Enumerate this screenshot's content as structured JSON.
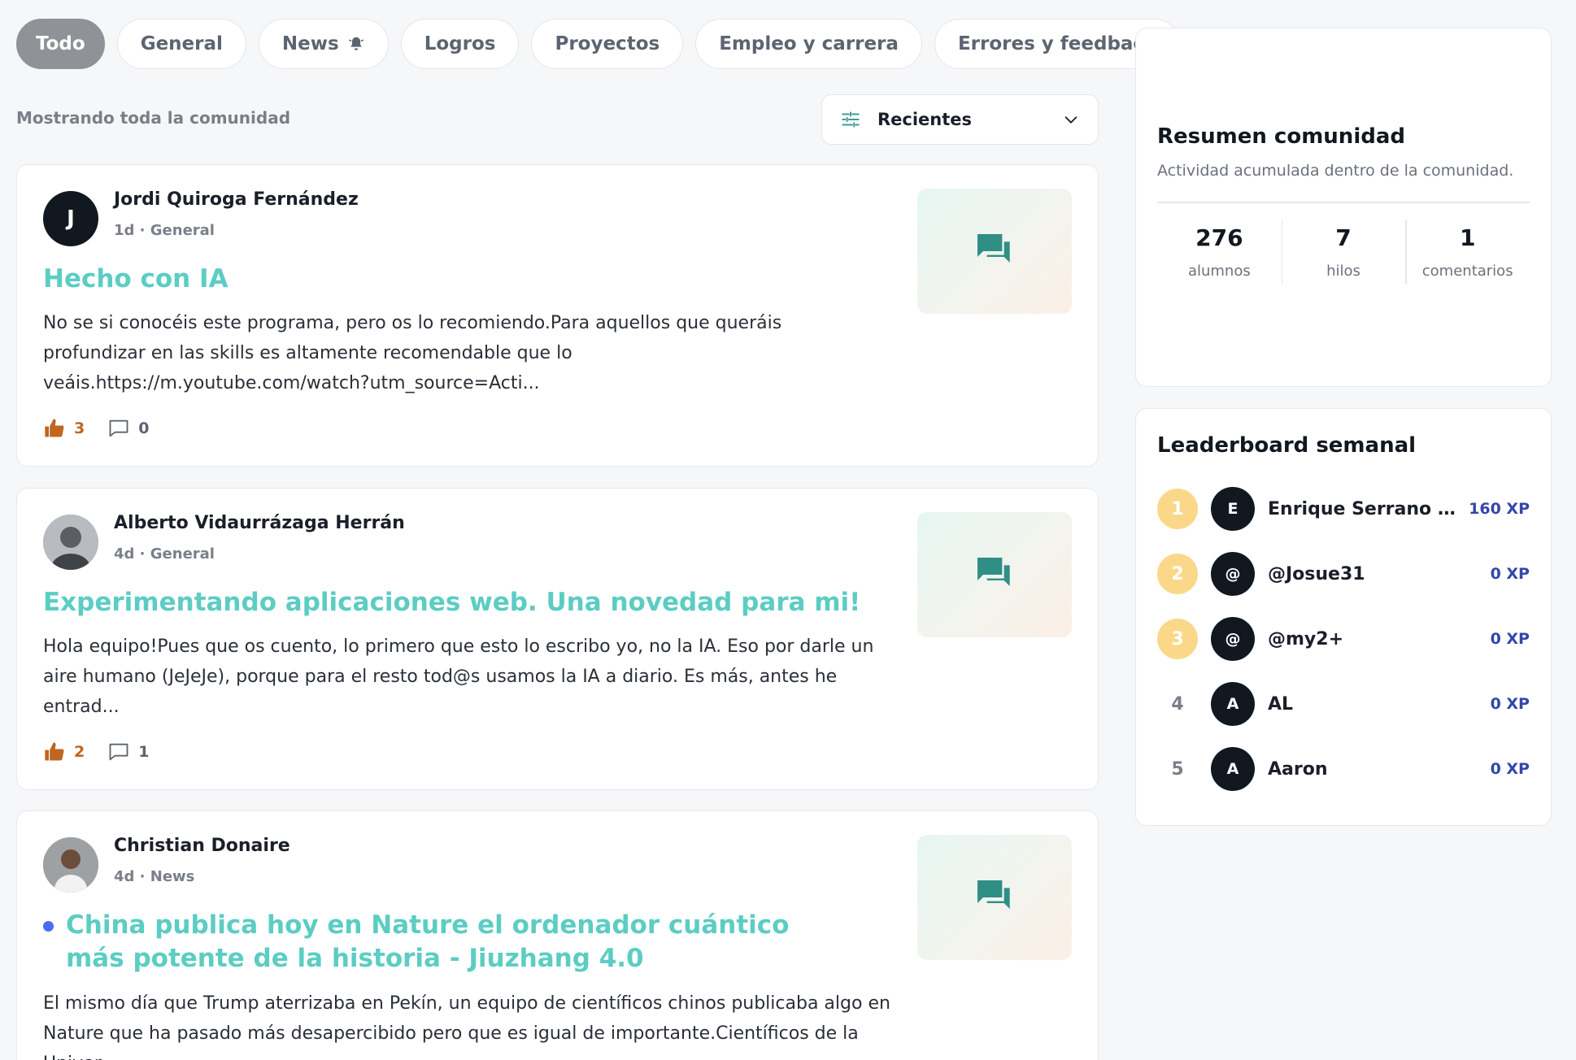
{
  "filters": [
    {
      "label": "Todo",
      "active": true
    },
    {
      "label": "General"
    },
    {
      "label": "News",
      "icon": "bell-icon"
    },
    {
      "label": "Logros"
    },
    {
      "label": "Proyectos"
    },
    {
      "label": "Empleo y carrera"
    },
    {
      "label": "Errores y feedback"
    }
  ],
  "subheader": {
    "showing": "Mostrando toda la comunidad",
    "sort_label": "Recientes"
  },
  "posts": [
    {
      "author": "Jordi Quiroga Fernández",
      "initial": "J",
      "meta": "1d · General",
      "title": "Hecho con IA",
      "excerpt": "No se si conocéis este programa, pero os lo recomiendo.Para aquellos que queráis profundizar en las skills es altamente recomendable que lo veáis.https://m.youtube.com/watch?utm_source=Acti...",
      "likes": "3",
      "comments": "0"
    },
    {
      "author": "Alberto Vidaurrázaga Herrán",
      "meta": "4d · General",
      "title": "Experimentando aplicaciones web. Una novedad para mi!",
      "excerpt": "Hola equipo!Pues que os cuento, lo primero que esto lo escribo yo, no la IA. Eso por darle un aire humano (JeJeJe), porque para el resto tod@s usamos la IA a diario. Es más, antes he entrad...",
      "likes": "2",
      "comments": "1"
    },
    {
      "author": "Christian Donaire",
      "meta": "4d · News",
      "title": "China publica hoy en Nature el ordenador cuántico más potente de la historia - Jiuzhang 4.0",
      "excerpt": "El mismo día que Trump aterrizaba en Pekín, un equipo de científicos chinos publicaba algo en Nature que ha pasado más desapercibido pero que es igual de importante.Científicos de la Univer..."
    }
  ],
  "summary": {
    "title": "Resumen comunidad",
    "subtitle": "Actividad acumulada dentro de la comunidad.",
    "stats": [
      {
        "value": "276",
        "label": "alumnos"
      },
      {
        "value": "7",
        "label": "hilos"
      },
      {
        "value": "1",
        "label": "comentarios"
      }
    ]
  },
  "leaderboard": {
    "title": "Leaderboard semanal",
    "entries": [
      {
        "rank": "1",
        "initial": "E",
        "name": "Enrique Serrano Ga...",
        "xp": "160 XP"
      },
      {
        "rank": "2",
        "initial": "@",
        "name": "@Josue31",
        "xp": "0 XP"
      },
      {
        "rank": "3",
        "initial": "@",
        "name": "@my2+",
        "xp": "0 XP"
      },
      {
        "rank": "4",
        "initial": "A",
        "name": "AL",
        "xp": "0 XP"
      },
      {
        "rank": "5",
        "initial": "A",
        "name": "Aaron",
        "xp": "0 XP"
      }
    ]
  },
  "colors": {
    "accent_title": "#5ccdc3",
    "like": "#c0661e",
    "xp": "#3446a8",
    "rank_badge": "#fbd889",
    "active_pill": "#8f9297"
  }
}
